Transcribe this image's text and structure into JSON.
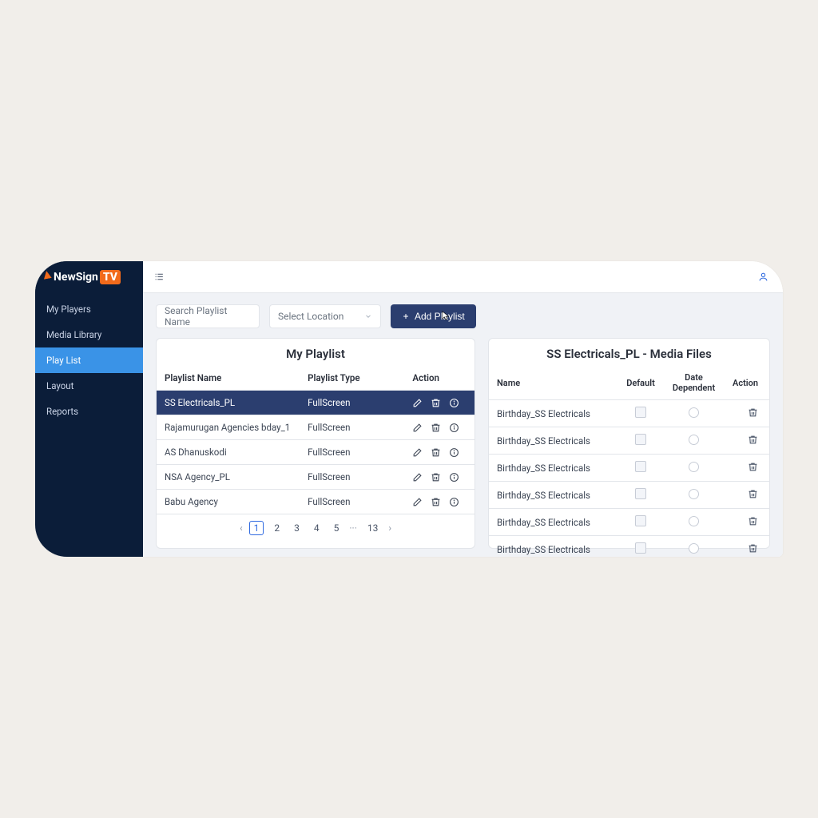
{
  "brand": {
    "name": "NewSign",
    "badge": "TV"
  },
  "sidebar": {
    "items": [
      {
        "label": "My Players",
        "active": false
      },
      {
        "label": "Media Library",
        "active": false
      },
      {
        "label": "Play List",
        "active": true
      },
      {
        "label": "Layout",
        "active": false
      },
      {
        "label": "Reports",
        "active": false
      }
    ]
  },
  "filters": {
    "search_placeholder": "Search Playlist Name",
    "location_placeholder": "Select Location",
    "add_button": "Add Playlist"
  },
  "playlist_panel": {
    "title": "My Playlist",
    "columns": {
      "name": "Playlist Name",
      "type": "Playlist Type",
      "action": "Action"
    },
    "rows": [
      {
        "name": "SS Electricals_PL",
        "type": "FullScreen",
        "selected": true
      },
      {
        "name": "Rajamurugan Agencies bday_1",
        "type": "FullScreen",
        "selected": false
      },
      {
        "name": "AS Dhanuskodi",
        "type": "FullScreen",
        "selected": false
      },
      {
        "name": "NSA Agency_PL",
        "type": "FullScreen",
        "selected": false
      },
      {
        "name": "Babu Agency",
        "type": "FullScreen",
        "selected": false
      }
    ],
    "pagination": {
      "pages": [
        "1",
        "2",
        "3",
        "4",
        "5"
      ],
      "ellipsis": "···",
      "last": "13",
      "current": "1"
    }
  },
  "media_panel": {
    "title": "SS Electricals_PL - Media Files",
    "columns": {
      "name": "Name",
      "default": "Default",
      "date_dep": "Date Dependent",
      "action": "Action"
    },
    "rows": [
      {
        "name": "Birthday_SS Electricals"
      },
      {
        "name": "Birthday_SS Electricals"
      },
      {
        "name": "Birthday_SS Electricals"
      },
      {
        "name": "Birthday_SS Electricals"
      },
      {
        "name": "Birthday_SS Electricals"
      },
      {
        "name": "Birthday_SS Electricals"
      }
    ]
  }
}
